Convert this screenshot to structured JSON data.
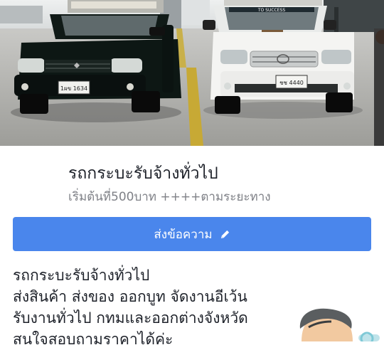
{
  "cover": {
    "left_plate": "1ผข 1634",
    "right_plate": "ชช 4440",
    "windshield_banner": "TO SUCCESS"
  },
  "page": {
    "title": "รถกระบะรับจ้างทั่วไป",
    "subtitle": "เริ่มต้นที่500บาท ++++ตามระยะทาง"
  },
  "actions": {
    "send_message_label": "ส่งข้อความ",
    "send_message_icon": "pencil-icon"
  },
  "description": {
    "lines": [
      "รถกระบะรับจ้างทั่วไป",
      "ส่งสินค้า ส่งของ ออกบูท จัดงานอีเว้น",
      "รับงานทั่วไป กทมและออกต่างจังหวัด",
      "สนใจสอบถามราคาได้ค่ะ"
    ]
  },
  "colors": {
    "button": "#4a86ec",
    "title_text": "#1d2129",
    "subtitle_text": "#7f8187"
  }
}
